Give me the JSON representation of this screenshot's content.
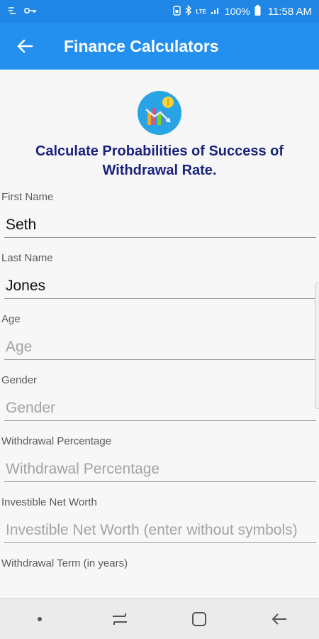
{
  "status_bar": {
    "battery_percent": "100%",
    "time": "11:58 AM",
    "network_label": "LTE",
    "icons": [
      "notification-icon",
      "key-icon",
      "sim-icon",
      "bluetooth-icon",
      "signal-icon",
      "battery-icon"
    ]
  },
  "app_bar": {
    "title": "Finance Calculators",
    "back_icon": "arrow-left-icon",
    "color": "#2390f0"
  },
  "headline": "Calculate Probabilities of Success of Withdrawal Rate.",
  "form": {
    "first_name": {
      "label": "First Name",
      "value": "Seth",
      "placeholder": "First Name"
    },
    "last_name": {
      "label": "Last Name",
      "value": "Jones",
      "placeholder": "Last Name"
    },
    "age": {
      "label": "Age",
      "value": "",
      "placeholder": "Age"
    },
    "gender": {
      "label": "Gender",
      "value": "",
      "placeholder": "Gender"
    },
    "withdrawal_percentage": {
      "label": "Withdrawal Percentage",
      "value": "",
      "placeholder": "Withdrawal Percentage"
    },
    "investible_net_worth": {
      "label": "Investible Net Worth",
      "value": "",
      "placeholder": "Investible Net Worth (enter without symbols)"
    },
    "withdrawal_term": {
      "label": "Withdrawal Term (in years)"
    }
  },
  "nav_bar": {
    "icons": [
      "dot-icon",
      "recent-apps-icon",
      "home-icon",
      "back-icon"
    ]
  },
  "colors": {
    "headline": "#1a237e",
    "status_bar": "#1f86e6",
    "logo": "#27a3e6"
  }
}
